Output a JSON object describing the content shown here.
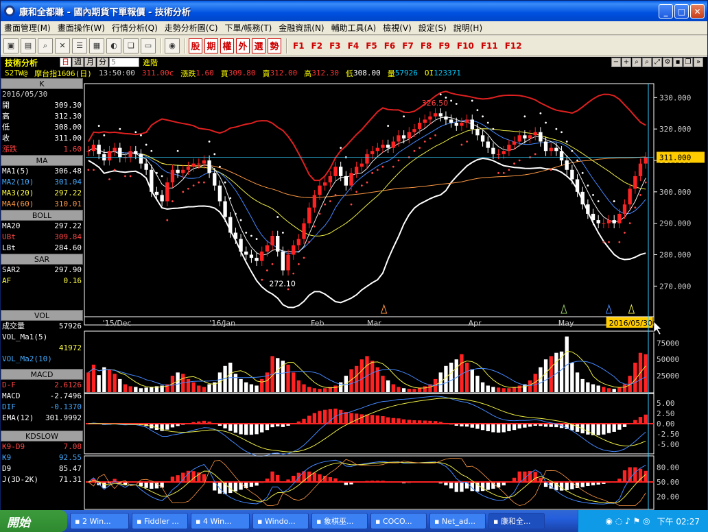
{
  "window": {
    "title": "康和全都賺 - 國內期貨下單報價 - 技術分析"
  },
  "menu": [
    "畫面管理(M)",
    "畫面操作(W)",
    "行情分析(Q)",
    "走勢分析圖(C)",
    "下單/帳務(T)",
    "金融資訊(N)",
    "輔助工具(A)",
    "檢視(V)",
    "設定(S)",
    "說明(H)"
  ],
  "quick_buttons": [
    "股",
    "期",
    "權",
    "外",
    "選",
    "勢"
  ],
  "function_keys": [
    "F1",
    "F2",
    "F3",
    "F4",
    "F5",
    "F6",
    "F7",
    "F8",
    "F9",
    "F10",
    "F11",
    "F12"
  ],
  "info_bar": {
    "title": "技術分析",
    "periods": [
      "日",
      "週",
      "月",
      "分"
    ],
    "active_period": "日",
    "period_value": "5",
    "advanced": "進階"
  },
  "quote": {
    "code": "S2TW@",
    "name": "摩台指1606(日)",
    "time": "13:50:00",
    "last": "311.00c",
    "change_label": "漲跌",
    "change": "1.60",
    "bid_label": "買",
    "bid": "309.80",
    "ask_label": "賣",
    "ask": "312.00",
    "high_label": "高",
    "high": "312.30",
    "low_label": "低",
    "low": "308.00",
    "vol_label": "量",
    "vol": "57926",
    "oi_label": "OI",
    "oi": "123371"
  },
  "panel": {
    "k_header": "K",
    "date": "2016/05/30",
    "k_rows": [
      {
        "label": "開",
        "value": "309.30"
      },
      {
        "label": "高",
        "value": "312.30"
      },
      {
        "label": "低",
        "value": "308.00"
      },
      {
        "label": "收",
        "value": "311.00"
      },
      {
        "label": "漲跌",
        "value": "1.60"
      }
    ],
    "ma_header": "MA",
    "ma_rows": [
      {
        "label": "MA1(5)",
        "value": "306.48"
      },
      {
        "label": "MA2(10)",
        "value": "301.04"
      },
      {
        "label": "MA3(20)",
        "value": "297.22"
      },
      {
        "label": "MA4(60)",
        "value": "310.01"
      }
    ],
    "boll_header": "BOLL",
    "boll_rows": [
      {
        "label": "MA20",
        "value": "297.22"
      },
      {
        "label": "UBt",
        "value": "309.84"
      },
      {
        "label": "LBt",
        "value": "284.60"
      }
    ],
    "sar_header": "SAR",
    "sar_rows": [
      {
        "label": "SAR2",
        "value": "297.90"
      },
      {
        "label": "AF",
        "value": "0.16"
      }
    ],
    "vol_header": "VOL",
    "vol_rows": [
      {
        "label": "成交量",
        "value": "57926"
      },
      {
        "label": "VOL_Ma1(5)",
        "value": ""
      },
      {
        "label": "",
        "value": "41972"
      },
      {
        "label": "VOL_Ma2(10)",
        "value": ""
      }
    ],
    "macd_header": "MACD",
    "macd_rows": [
      {
        "label": "D-F",
        "value": "2.6126"
      },
      {
        "label": "MACD",
        "value": "-2.7496"
      },
      {
        "label": "DIF",
        "value": "-0.1370"
      },
      {
        "label": "EMA(12)",
        "value": "301.9992"
      }
    ],
    "kd_header": "KDSLOW",
    "kd_rows": [
      {
        "label": "K9-D9",
        "value": "7.08"
      },
      {
        "label": "K9",
        "value": "92.55"
      },
      {
        "label": "D9",
        "value": "85.47"
      },
      {
        "label": "J(3D-2K)",
        "value": "71.31"
      }
    ]
  },
  "chart_data": {
    "type": "candlestick",
    "price_axis": {
      "ticks": [
        "330.000",
        "320.000",
        "310.000",
        "300.000",
        "290.000",
        "280.000",
        "270.000"
      ],
      "min": 262,
      "max": 334,
      "current": "311.000"
    },
    "x_labels": [
      "'15/Dec",
      "'16/Jan",
      "Feb",
      "Mar",
      "Apr",
      "May",
      "2016/05/30"
    ],
    "annotations": {
      "high": "326.50",
      "low": "272.10"
    },
    "vol_axis": [
      "75000",
      "50000",
      "25000"
    ],
    "macd_axis": [
      "5.00",
      "2.50",
      "0.00",
      "-2.50",
      "-5.00"
    ],
    "kd_axis": [
      "80.00",
      "50.00",
      "20.00"
    ],
    "closes": [
      313,
      315,
      312,
      310,
      313,
      314,
      311,
      311,
      313,
      312,
      309,
      307,
      300,
      299,
      297,
      303,
      307,
      306,
      307,
      308,
      309,
      309,
      310,
      306,
      302,
      297,
      292,
      287,
      285,
      281,
      280,
      279,
      278,
      281,
      283,
      286,
      281,
      275,
      280,
      283,
      285,
      290,
      295,
      299,
      302,
      303,
      305,
      308,
      305,
      302,
      306,
      308,
      309,
      312,
      313,
      314,
      315,
      314,
      316,
      318,
      317,
      319,
      320,
      322,
      323,
      324,
      325,
      324,
      323,
      322,
      321,
      322,
      323,
      320,
      318,
      316,
      314,
      312,
      312,
      313,
      315,
      316,
      318,
      317,
      318,
      319,
      316,
      313,
      314,
      313,
      310,
      307,
      304,
      300,
      296,
      293,
      291,
      290,
      290,
      291,
      290,
      293,
      296,
      301,
      305,
      309,
      311
    ],
    "volumes": [
      30000,
      42000,
      26000,
      38000,
      35000,
      28000,
      20000,
      12000,
      9000,
      8000,
      6000,
      7000,
      8000,
      9000,
      10000,
      12000,
      25000,
      30000,
      28000,
      20000,
      15000,
      10000,
      8000,
      12000,
      15000,
      30000,
      40000,
      45000,
      28000,
      20000,
      15000,
      12000,
      10000,
      20000,
      30000,
      55000,
      52000,
      48000,
      42000,
      30000,
      18000,
      12000,
      8000,
      6000,
      5000,
      6000,
      8000,
      10000,
      15000,
      25000,
      35000,
      40000,
      50000,
      55000,
      48000,
      38000,
      25000,
      18000,
      12000,
      8000,
      6000,
      5000,
      5000,
      7000,
      9000,
      12000,
      20000,
      30000,
      40000,
      45000,
      50000,
      58000,
      45000,
      35000,
      25000,
      15000,
      10000,
      8000,
      7000,
      6000,
      6000,
      8000,
      10000,
      12000,
      18000,
      28000,
      38000,
      50000,
      55000,
      60000,
      62000,
      85000,
      45000,
      30000,
      20000,
      15000,
      12000,
      10000,
      8000,
      6000,
      5000,
      7000,
      12000,
      25000,
      45000,
      60000,
      57926
    ]
  }
}
